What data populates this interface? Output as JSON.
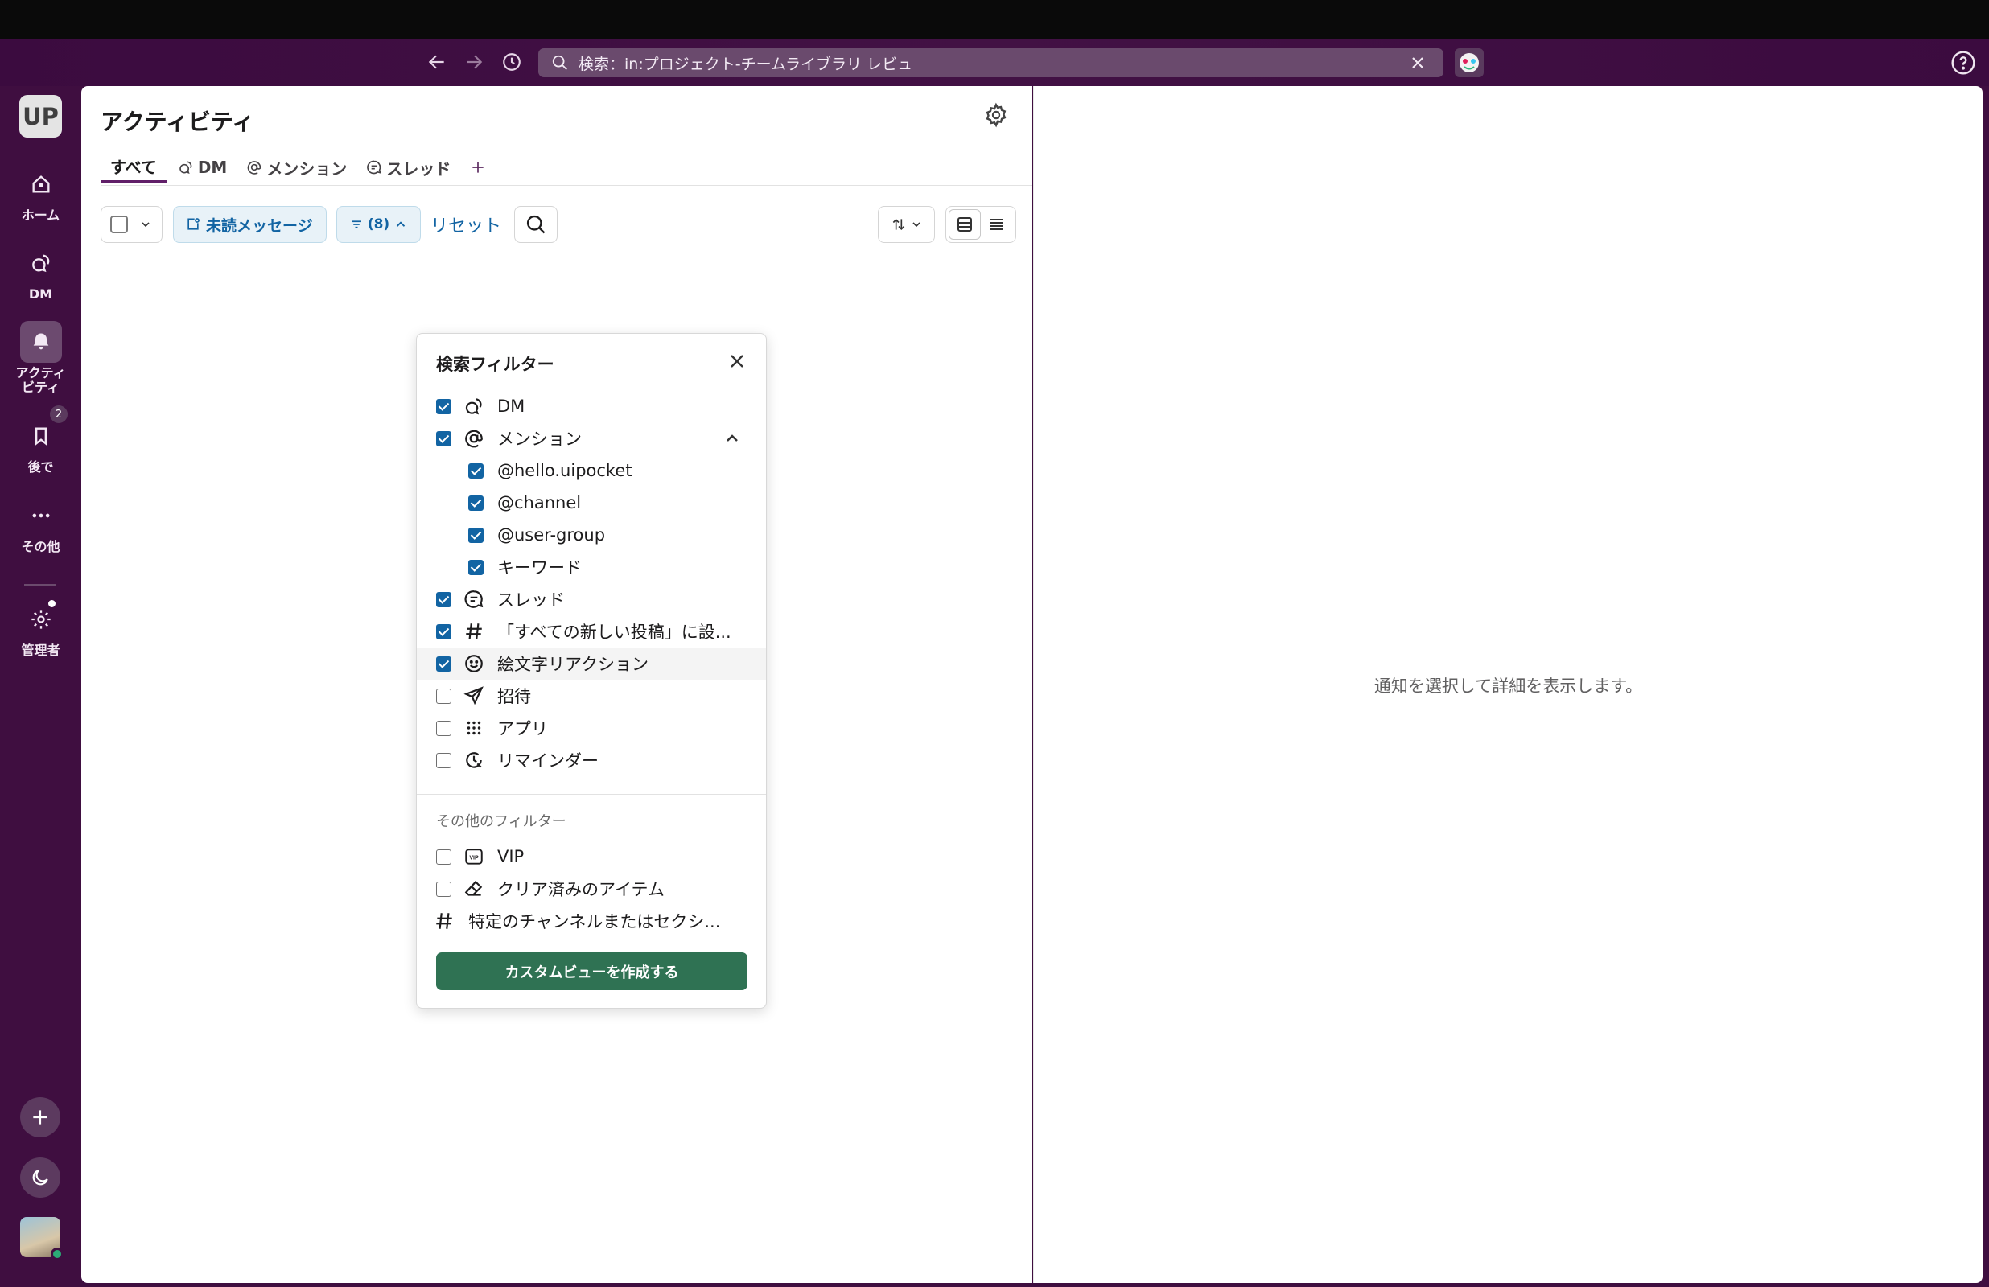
{
  "topbar": {
    "search_text": "検索：in:プロジェクト-チームライブラリ レビュ"
  },
  "sidebar": {
    "workspace_initials": "UP",
    "items": [
      {
        "label": "ホーム",
        "icon": "home-icon"
      },
      {
        "label": "DM",
        "icon": "dm-icon"
      },
      {
        "label": "アクティビティ",
        "icon": "bell-icon"
      },
      {
        "label": "後で",
        "icon": "bookmark-icon",
        "badge": "2"
      },
      {
        "label": "その他",
        "icon": "more-icon"
      },
      {
        "label": "管理者",
        "icon": "gear-icon"
      }
    ]
  },
  "activity": {
    "title": "アクティビティ",
    "tabs": [
      {
        "label": "すべて"
      },
      {
        "label": "DM"
      },
      {
        "label": "メンション"
      },
      {
        "label": "スレッド"
      }
    ],
    "toolbar": {
      "unread_label": "未読メッセージ",
      "filter_count": "(8)",
      "reset_label": "リセット"
    }
  },
  "filter_popup": {
    "title": "検索フィルター",
    "items": [
      {
        "label": "DM",
        "checked": true
      },
      {
        "label": "メンション",
        "checked": true
      },
      {
        "label": "@hello.uipocket",
        "checked": true
      },
      {
        "label": "@channel",
        "checked": true
      },
      {
        "label": "@user-group",
        "checked": true
      },
      {
        "label": "キーワード",
        "checked": true
      },
      {
        "label": "スレッド",
        "checked": true
      },
      {
        "label": "「すべての新しい投稿」に設...",
        "checked": true
      },
      {
        "label": "絵文字リアクション",
        "checked": true
      },
      {
        "label": "招待",
        "checked": false
      },
      {
        "label": "アプリ",
        "checked": false
      },
      {
        "label": "リマインダー",
        "checked": false
      }
    ],
    "other_heading": "その他のフィルター",
    "other_items": [
      {
        "label": "VIP",
        "checked": false
      },
      {
        "label": "クリア済みのアイテム",
        "checked": false
      },
      {
        "label": "特定のチャンネルまたはセクシ..."
      }
    ],
    "create_button": "カスタムビューを作成する"
  },
  "detail": {
    "empty_message": "通知を選択して詳細を表示します。"
  },
  "colors": {
    "sidebar_bg": "#3f0e40",
    "accent": "#611f69",
    "link_blue": "#1264a3",
    "primary_button": "#2f7253"
  }
}
